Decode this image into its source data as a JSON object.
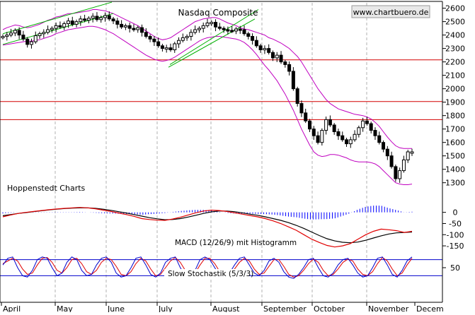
{
  "chart_data": [
    {
      "type": "candlestick",
      "title": "Nasdaq Composite",
      "watermark": "www.chartbuero.de",
      "caption": "Hoppenstedt Charts",
      "x_labels": [
        "April",
        "May",
        "June",
        "July",
        "August",
        "September",
        "October",
        "November",
        "Decem"
      ],
      "y_ticks": [
        1300,
        1400,
        1500,
        1600,
        1700,
        1800,
        1900,
        2000,
        2100,
        2200,
        2300,
        2400,
        2500,
        2600
      ],
      "ylim": [
        1230,
        2640
      ],
      "grid": "vertical dashed",
      "series": [
        {
          "name": "close",
          "values": [
            2390,
            2400,
            2415,
            2435,
            2400,
            2370,
            2330,
            2350,
            2395,
            2410,
            2420,
            2440,
            2450,
            2470,
            2460,
            2485,
            2505,
            2480,
            2500,
            2520,
            2510,
            2525,
            2540,
            2515,
            2530,
            2545,
            2520,
            2505,
            2480,
            2460,
            2470,
            2450,
            2440,
            2455,
            2420,
            2390,
            2370,
            2350,
            2320,
            2300,
            2305,
            2290,
            2335,
            2360,
            2380,
            2390,
            2420,
            2440,
            2450,
            2470,
            2490,
            2495,
            2460,
            2450,
            2440,
            2435,
            2430,
            2445,
            2440,
            2410,
            2390,
            2360,
            2320,
            2290,
            2300,
            2270,
            2230,
            2250,
            2200,
            2180,
            2130,
            2000,
            1890,
            1820,
            1760,
            1700,
            1650,
            1600,
            1690,
            1770,
            1730,
            1680,
            1650,
            1620,
            1590,
            1620,
            1660,
            1710,
            1760,
            1740,
            1690,
            1650,
            1600,
            1550,
            1500,
            1420,
            1330,
            1390,
            1470,
            1530,
            1530
          ]
        },
        {
          "name": "upper band",
          "values": [
            2440,
            2455,
            2465,
            2475,
            2470,
            2460,
            2455,
            2460,
            2470,
            2480,
            2495,
            2510,
            2520,
            2535,
            2540,
            2550,
            2560,
            2560,
            2565,
            2570,
            2575,
            2580,
            2590,
            2590,
            2585,
            2580,
            2570,
            2560,
            2545,
            2530,
            2515,
            2500,
            2485,
            2470,
            2450,
            2430,
            2410,
            2390,
            2375,
            2365,
            2370,
            2380,
            2400,
            2420,
            2440,
            2460,
            2480,
            2500,
            2510,
            2520,
            2525,
            2530,
            2530,
            2520,
            2505,
            2490,
            2480,
            2470,
            2455,
            2445,
            2440,
            2430,
            2420,
            2410,
            2400,
            2380,
            2370,
            2355,
            2340,
            2320,
            2300,
            2270,
            2240,
            2200,
            2150,
            2100,
            2050,
            2000,
            1960,
            1920,
            1890,
            1870,
            1850,
            1840,
            1830,
            1820,
            1810,
            1805,
            1800,
            1790,
            1775,
            1750,
            1720,
            1680,
            1640,
            1605,
            1575,
            1560,
            1555,
            1555,
            1555
          ]
        },
        {
          "name": "lower band",
          "values": [
            2325,
            2330,
            2335,
            2340,
            2345,
            2350,
            2355,
            2355,
            2360,
            2365,
            2375,
            2385,
            2395,
            2410,
            2420,
            2430,
            2440,
            2445,
            2450,
            2455,
            2460,
            2465,
            2465,
            2460,
            2450,
            2440,
            2425,
            2410,
            2390,
            2370,
            2350,
            2330,
            2310,
            2290,
            2270,
            2250,
            2235,
            2220,
            2210,
            2205,
            2210,
            2220,
            2235,
            2255,
            2275,
            2295,
            2315,
            2335,
            2355,
            2370,
            2380,
            2385,
            2390,
            2390,
            2385,
            2380,
            2375,
            2370,
            2360,
            2345,
            2320,
            2290,
            2255,
            2215,
            2175,
            2140,
            2100,
            2060,
            2010,
            1960,
            1900,
            1840,
            1770,
            1700,
            1640,
            1580,
            1530,
            1505,
            1495,
            1500,
            1510,
            1510,
            1505,
            1495,
            1485,
            1470,
            1460,
            1455,
            1455,
            1455,
            1450,
            1440,
            1420,
            1390,
            1360,
            1330,
            1300,
            1290,
            1285,
            1285,
            1290
          ]
        },
        {
          "name": "channel-1",
          "values": [
            [
              2380,
              2485
            ],
            [
              2455,
              2645
            ]
          ]
        },
        {
          "name": "channel-2",
          "values": [
            [
              2330,
              2410
            ],
            [
              2375,
              2560
            ]
          ]
        },
        {
          "name": "channel-3",
          "values": [
            [
              2255,
              2380
            ],
            [
              2430,
              2590
            ]
          ]
        },
        {
          "name": "channel-4",
          "values": [
            [
              2210,
              2327
            ],
            [
              2305,
              2520
            ]
          ]
        }
      ],
      "horizontal_lines": [
        2215,
        1905,
        1770
      ]
    },
    {
      "type": "line",
      "title": "MACD (12/26/9) mit Histogramm",
      "y_ticks": [
        0,
        -50,
        -100,
        -150
      ],
      "ylim": [
        -175,
        40
      ],
      "series": [
        {
          "name": "MACD",
          "values": [
            -20,
            -12,
            -5,
            0,
            4,
            8,
            12,
            15,
            18,
            20,
            22,
            20,
            16,
            10,
            4,
            -3,
            -10,
            -18,
            -28,
            -32,
            -35,
            -36,
            -30,
            -22,
            -12,
            -2,
            6,
            10,
            8,
            4,
            -2,
            -8,
            -14,
            -20,
            -28,
            -38,
            -50,
            -65,
            -80,
            -100,
            -120,
            -135,
            -148,
            -155,
            -150,
            -140,
            -120,
            -100,
            -85,
            -75,
            -78,
            -82,
            -90,
            -85
          ]
        },
        {
          "name": "Signal",
          "values": [
            -15,
            -10,
            -5,
            -1,
            3,
            7,
            11,
            14,
            17,
            19,
            20,
            20,
            18,
            14,
            9,
            3,
            -3,
            -10,
            -17,
            -24,
            -29,
            -33,
            -32,
            -28,
            -21,
            -13,
            -5,
            2,
            6,
            6,
            3,
            -2,
            -8,
            -13,
            -20,
            -28,
            -36,
            -46,
            -58,
            -72,
            -88,
            -104,
            -118,
            -128,
            -134,
            -136,
            -133,
            -125,
            -115,
            -105,
            -97,
            -92,
            -90,
            -88
          ]
        },
        {
          "name": "Histogram",
          "values": [
            -5,
            -2,
            0,
            1,
            1,
            1,
            1,
            1,
            1,
            1,
            2,
            0,
            -2,
            -4,
            -5,
            -6,
            -7,
            -8,
            -11,
            -8,
            -6,
            -3,
            2,
            6,
            9,
            11,
            11,
            8,
            2,
            -2,
            -5,
            -6,
            -6,
            -7,
            -8,
            -10,
            -14,
            -19,
            -22,
            -28,
            -32,
            -31,
            -30,
            -27,
            -16,
            -4,
            13,
            25,
            30,
            30,
            19,
            10,
            0,
            3
          ]
        }
      ]
    },
    {
      "type": "line",
      "title": "Slow Stochastik (5/3/3)",
      "y_ticks": [
        50
      ],
      "ylim": [
        0,
        100
      ],
      "horizontal_lines": [
        80,
        20
      ],
      "series": [
        {
          "name": "%K",
          "values": [
            60,
            85,
            90,
            50,
            20,
            15,
            40,
            80,
            90,
            85,
            50,
            20,
            30,
            70,
            90,
            80,
            40,
            20,
            25,
            60,
            85,
            90,
            70,
            30,
            15,
            20,
            50,
            85,
            90,
            60,
            25,
            15,
            30,
            70,
            85,
            90,
            50,
            20,
            15,
            40,
            80,
            90,
            80,
            50,
            20,
            15,
            30,
            60,
            85,
            90,
            60,
            30,
            20,
            40,
            75,
            85,
            70,
            35,
            15,
            10,
            25,
            50,
            80,
            85,
            50,
            20,
            15,
            30,
            60,
            80,
            85,
            60,
            30,
            15,
            20,
            50,
            85,
            90,
            60,
            25,
            15,
            40,
            75,
            90
          ]
        },
        {
          "name": "%D",
          "values": [
            65,
            75,
            85,
            75,
            45,
            25,
            30,
            60,
            85,
            88,
            70,
            40,
            30,
            50,
            80,
            85,
            65,
            35,
            25,
            40,
            70,
            85,
            80,
            55,
            25,
            20,
            35,
            65,
            85,
            75,
            45,
            20,
            25,
            50,
            75,
            88,
            70,
            40,
            20,
            30,
            60,
            85,
            85,
            65,
            35,
            20,
            25,
            45,
            70,
            85,
            75,
            45,
            25,
            30,
            55,
            80,
            80,
            55,
            25,
            15,
            20,
            40,
            65,
            82,
            70,
            40,
            20,
            25,
            45,
            70,
            82,
            75,
            45,
            25,
            20,
            35,
            65,
            88,
            75,
            45,
            20,
            30,
            60,
            85
          ]
        }
      ]
    }
  ]
}
